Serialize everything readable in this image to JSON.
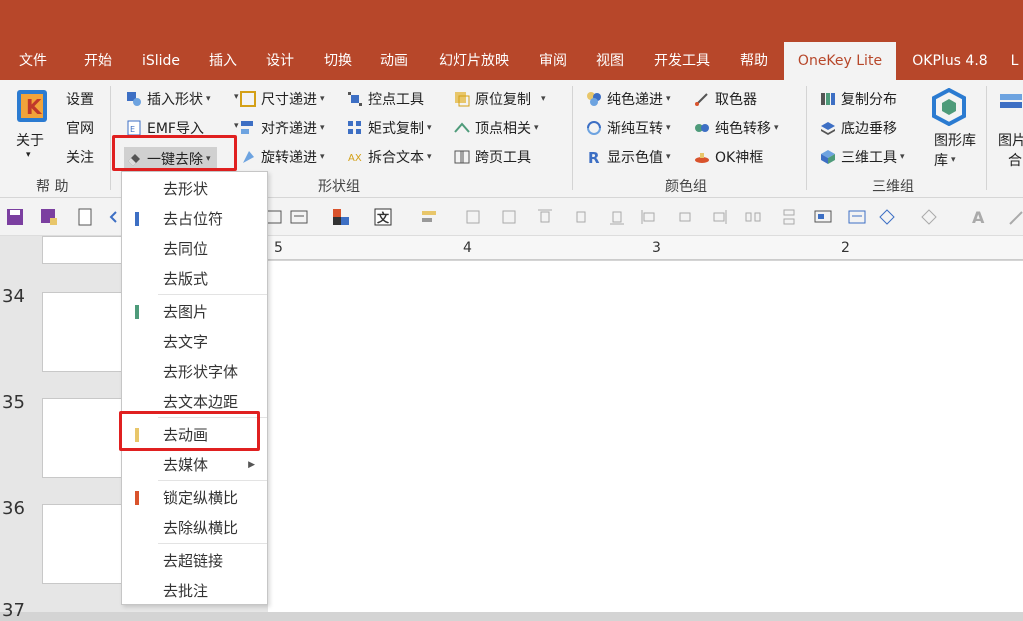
{
  "tabs": [
    "文件",
    "开始",
    "iSlide",
    "插入",
    "设计",
    "切换",
    "动画",
    "幻灯片放映",
    "审阅",
    "视图",
    "开发工具",
    "帮助",
    "OneKey Lite",
    "OKPlus 4.8",
    "L"
  ],
  "help_group": {
    "about": "关于",
    "settings": "设置",
    "website": "官网",
    "follow": "关注",
    "label": "帮 助"
  },
  "shape_group": {
    "insert_shape": "插入形状",
    "emf_import": "EMF导入",
    "one_key_remove": "一键去除",
    "size_increment": "尺寸递进",
    "align_increment": "对齐递进",
    "rotate_increment": "旋转递进",
    "control_point_tool": "控点工具",
    "matrix_copy": "矩式复制",
    "split_text": "拆合文本",
    "in_place_copy": "原位复制",
    "vertex_related": "顶点相关",
    "cross_page_tool": "跨页工具",
    "label": "形状组"
  },
  "color_group": {
    "solid_increment": "纯色递进",
    "gradient_solid_swap": "渐纯互转",
    "show_color_value": "显示色值",
    "color_picker": "取色器",
    "solid_transfer": "纯色转移",
    "ok_frame": "OK神框",
    "label": "颜色组"
  },
  "three_d_group": {
    "copy_distribute": "复制分布",
    "bottom_vertical": "底边垂移",
    "three_d_tool": "三维工具",
    "shape_library": "图形库",
    "image": "图片",
    "merge": "合",
    "label": "三维组"
  },
  "ruler": [
    "5",
    "4",
    "3",
    "2"
  ],
  "slides": [
    "34",
    "35",
    "36",
    "37"
  ],
  "dropdown": [
    "去形状",
    "去占位符",
    "去同位",
    "去版式",
    "去图片",
    "去文字",
    "去形状字体",
    "去文本边距",
    "去动画",
    "去媒体",
    "锁定纵横比",
    "去除纵横比",
    "去超链接",
    "去批注"
  ],
  "colors": {
    "accent": "#b7472a",
    "bar_blue": "#3d6fc4",
    "bar_green": "#4e9b7a",
    "bar_yellow": "#e8c66a",
    "bar_orange": "#d9532c",
    "highlight": "#e02020"
  }
}
